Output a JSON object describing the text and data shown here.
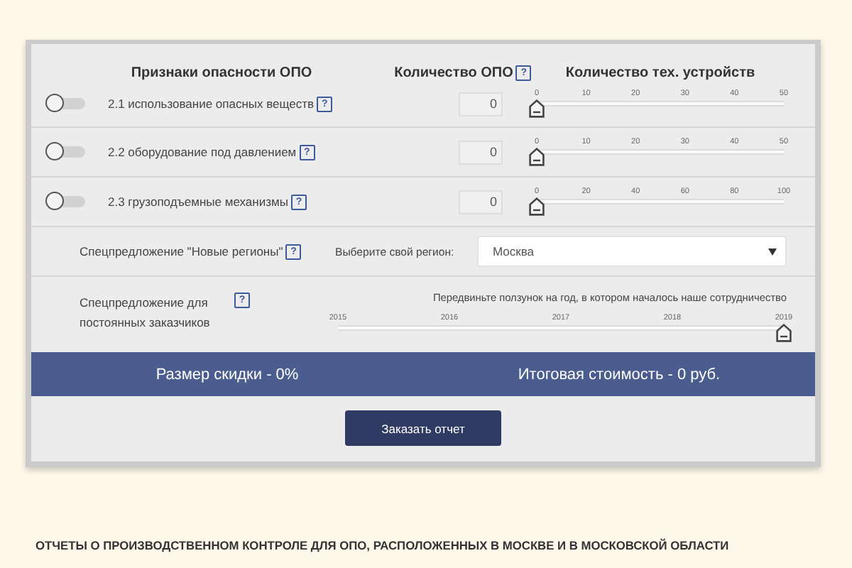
{
  "header": {
    "column_1": "Признаки опасности ОПО",
    "column_2": "Количество ОПО",
    "column_2_help": "?",
    "column_3": "Количество тех. устройств"
  },
  "hazards": [
    {
      "label": "2.1 использование опасных веществ",
      "help": "?",
      "on": false,
      "count": "0",
      "ticks": [
        "0",
        "10",
        "20",
        "30",
        "40",
        "50"
      ],
      "level": 0
    },
    {
      "label": "2.2 оборудование под давлением",
      "help": "?",
      "on": false,
      "count": "0",
      "ticks": [
        "0",
        "10",
        "20",
        "30",
        "40",
        "50"
      ],
      "level": 0
    },
    {
      "label": "2.3 грузоподъемные механизмы",
      "help": "?",
      "on": false,
      "count": "0",
      "ticks": [
        "0",
        "20",
        "40",
        "60",
        "80",
        "100"
      ],
      "level": 0
    }
  ],
  "region_offer": {
    "label": "Спецпредложение \"Новые регионы\"",
    "help": "?",
    "select_label": "Выберите свой регион:",
    "value": "Москва"
  },
  "loyalty_offer": {
    "label": "Спецпредложение для постоянных заказчиков",
    "help": "?",
    "hint": "Передвиньте ползунок на год, в котором началось наше сотрудничество",
    "ticks": [
      "2015",
      "2016",
      "2017",
      "2018",
      "2019"
    ],
    "level": 1
  },
  "summary": {
    "discount": "Размер скидки - 0%",
    "total": "Итоговая стоимость - 0 руб."
  },
  "order_button": "Заказать отчет",
  "section_heading": "ОТЧЕТЫ О ПРОИЗВОДСТВЕННОМ КОНТРОЛЕ ДЛЯ ОПО, РАСПОЛОЖЕННЫХ В МОСКВЕ И В МОСКОВСКОЙ ОБЛАСТИ"
}
